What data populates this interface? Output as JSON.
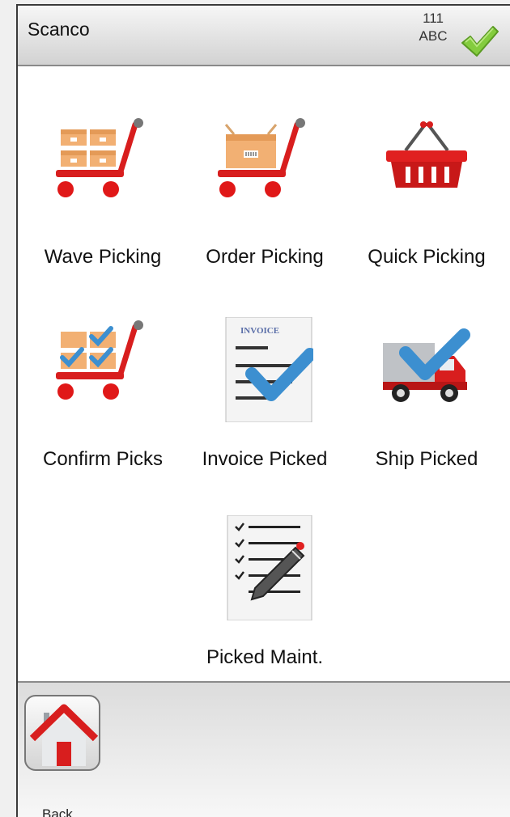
{
  "header": {
    "title": "Scanco",
    "status_code": "111",
    "status_sub": "ABC",
    "confirm_icon": "green-checkmark-icon"
  },
  "menu": {
    "items": [
      {
        "label": "Wave Picking",
        "icon": "wave-picking-cart-icon"
      },
      {
        "label": "Order Picking",
        "icon": "order-picking-cart-icon"
      },
      {
        "label": "Quick Picking",
        "icon": "basket-icon"
      },
      {
        "label": "Confirm Picks",
        "icon": "confirm-picks-cart-icon"
      },
      {
        "label": "Invoice Picked",
        "icon": "invoice-check-icon"
      },
      {
        "label": "Ship Picked",
        "icon": "truck-check-icon"
      },
      {
        "label": "Picked Maint.",
        "icon": "checklist-pencil-icon"
      }
    ],
    "invoice_doc_text": "INVOICE"
  },
  "footer": {
    "back_label": "Back",
    "back_icon": "home-icon"
  },
  "colors": {
    "accent_red": "#d81e1e",
    "check_blue": "#3c8fd0",
    "check_green": "#7cc63a"
  }
}
